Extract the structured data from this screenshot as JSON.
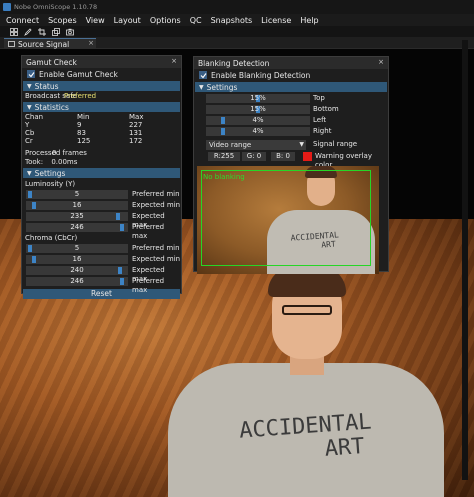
{
  "window": {
    "title": "Nobe OmniScope 1.10.78"
  },
  "menu": [
    "Connect",
    "Scopes",
    "View",
    "Layout",
    "Options",
    "QC",
    "Snapshots",
    "License",
    "Help"
  ],
  "toolbar_icons": [
    "grid-icon",
    "pen-icon",
    "crop-icon",
    "layers-icon",
    "camera-icon"
  ],
  "tab": {
    "label": "Source Signal",
    "close": "×"
  },
  "gamut": {
    "title": "Gamut Check",
    "close": "×",
    "enable_label": "Enable Gamut Check",
    "status_header": "Status",
    "broadcast": "Broadcast safe",
    "broadcast_overlay": "Preferred",
    "statistics_header": "Statistics",
    "stats_headers": [
      "Chan",
      "Min",
      "Max"
    ],
    "stats_rows": [
      [
        "Y",
        "9",
        "227"
      ],
      [
        "Cb",
        "83",
        "131"
      ],
      [
        "Cr",
        "125",
        "172"
      ]
    ],
    "processed": "Processed frames",
    "processed_overlay": "0",
    "took": "Took:",
    "took_value": "0.00ms",
    "settings_header": "Settings",
    "luminosity_label": "Luminosity (Y)",
    "luminosity": [
      {
        "value": "5",
        "label": "Preferred min",
        "level": 0.02
      },
      {
        "value": "16",
        "label": "Expected min",
        "level": 0.06
      },
      {
        "value": "235",
        "label": "Expected max",
        "level": 0.92
      },
      {
        "value": "246",
        "label": "Preferred max",
        "level": 0.96
      }
    ],
    "chroma_label": "Chroma (CbCr)",
    "chroma": [
      {
        "value": "5",
        "label": "Preferred min",
        "level": 0.02
      },
      {
        "value": "16",
        "label": "Expected min",
        "level": 0.06
      },
      {
        "value": "240",
        "label": "Expected max",
        "level": 0.94
      },
      {
        "value": "246",
        "label": "Preferred max",
        "level": 0.96
      }
    ],
    "reset": "Reset"
  },
  "blanking": {
    "title": "Blanking Detection",
    "close": "×",
    "enable_label": "Enable Blanking Detection",
    "settings_header": "Settings",
    "sliders": [
      {
        "value": "15%",
        "label": "Top",
        "level": 0.5
      },
      {
        "value": "15%",
        "label": "Bottom",
        "level": 0.5
      },
      {
        "value": "4%",
        "label": "Left",
        "level": 0.15
      },
      {
        "value": "4%",
        "label": "Right",
        "level": 0.15
      }
    ],
    "range_value": "Video range",
    "range_label": "Signal range",
    "r": "R:255",
    "g": "G: 0",
    "b": "B: 0",
    "warning_label": "Warning overlay color",
    "warning_color": "#e41b17",
    "preview_status": "No blanking",
    "shirt_line1": "ACCIDENTAL",
    "shirt_line2": "ART"
  },
  "scene": {
    "shirt_line1": "ACCIDENTAL",
    "shirt_line2": "ART"
  }
}
